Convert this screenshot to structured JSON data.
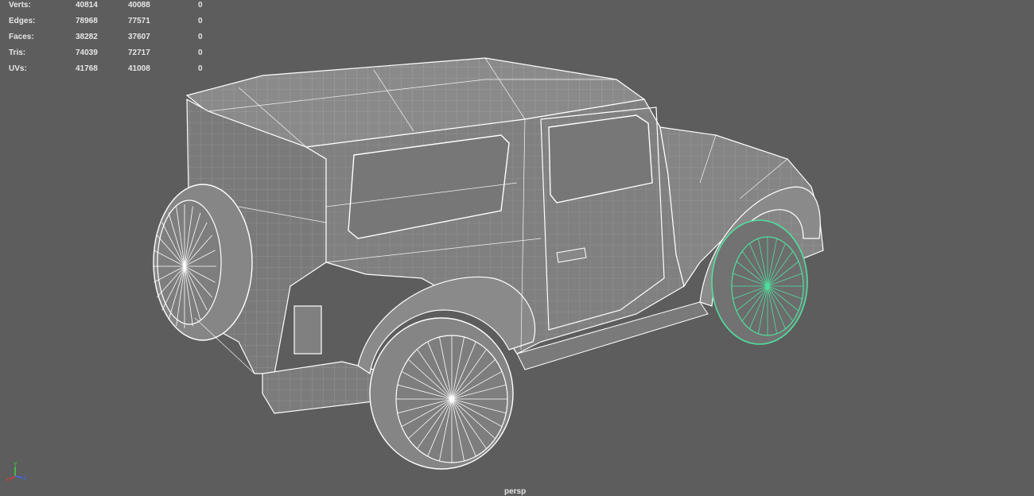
{
  "viewport": {
    "camera": "persp",
    "background_color": "#5d5d5d",
    "wire_color": "#ffffff",
    "selected_wire_color": "#4fe0a0"
  },
  "hud": {
    "rows": [
      {
        "label": "Verts:",
        "v1": "40814",
        "v2": "40088",
        "v3": "0"
      },
      {
        "label": "Edges:",
        "v1": "78968",
        "v2": "77571",
        "v3": "0"
      },
      {
        "label": "Faces:",
        "v1": "38282",
        "v2": "37607",
        "v3": "0"
      },
      {
        "label": "Tris:",
        "v1": "74039",
        "v2": "72717",
        "v3": "0"
      },
      {
        "label": "UVs:",
        "v1": "41768",
        "v2": "41008",
        "v3": "0"
      }
    ]
  },
  "gizmo": {
    "x": "X",
    "y": "Y",
    "z": "Z"
  }
}
